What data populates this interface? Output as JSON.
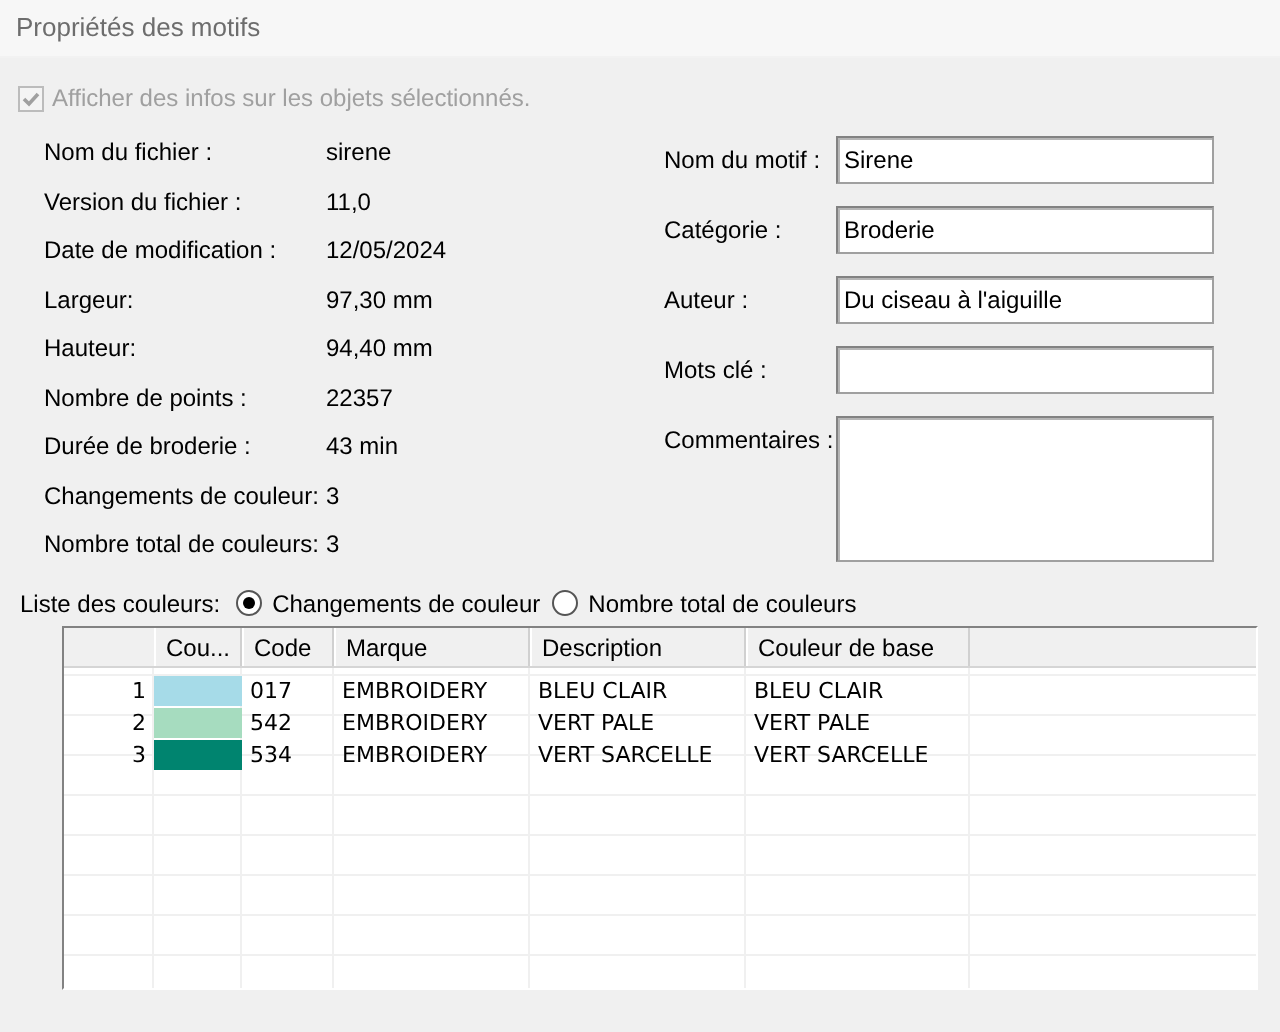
{
  "window": {
    "title": "Propriétés des motifs"
  },
  "show_info": {
    "label": "Afficher des infos sur les objets sélectionnés.",
    "checked": true,
    "disabled": true
  },
  "info": [
    {
      "label": "Nom du fichier :",
      "value": "sirene"
    },
    {
      "label": "Version du fichier :",
      "value": "11,0"
    },
    {
      "label": "Date de modification :",
      "value": "12/05/2024"
    },
    {
      "label": "Largeur:",
      "value": "97,30 mm"
    },
    {
      "label": "Hauteur:",
      "value": "94,40 mm"
    },
    {
      "label": "Nombre de points :",
      "value": "22357"
    },
    {
      "label": "Durée de broderie :",
      "value": "43 min"
    },
    {
      "label": "Changements de couleur:",
      "value": "3"
    },
    {
      "label": "Nombre total de couleurs:",
      "value": "3"
    }
  ],
  "fields": [
    {
      "label": "Nom du motif :",
      "value": "Sirene",
      "kind": "line"
    },
    {
      "label": "Catégorie :",
      "value": "Broderie",
      "kind": "line"
    },
    {
      "label": "Auteur :",
      "value": "Du ciseau à l'aiguille",
      "kind": "line"
    },
    {
      "label": "Mots clé :",
      "kind": "line"
    },
    {
      "label": "Commentaires :",
      "kind": "area"
    }
  ],
  "color_list": {
    "label": "Liste des couleurs:",
    "options": [
      {
        "label": "Changements de couleur",
        "selected": true
      },
      {
        "label": "Nombre total de couleurs",
        "selected": false
      }
    ]
  },
  "table": {
    "columns": [
      "Cou...",
      "Code",
      "Marque",
      "Description",
      "Couleur de base"
    ],
    "rows": [
      {
        "index": "1",
        "color": "#a6dbe8",
        "code": "017",
        "brand": "EMBROIDERY",
        "description": "BLEU CLAIR",
        "base_color": "BLEU CLAIR"
      },
      {
        "index": "2",
        "color": "#a6dcbf",
        "code": "542",
        "brand": "EMBROIDERY",
        "description": "VERT PALE",
        "base_color": "VERT PALE"
      },
      {
        "index": "3",
        "color": "#00846f",
        "code": "534",
        "brand": "EMBROIDERY",
        "description": "VERT SARCELLE",
        "base_color": "VERT SARCELLE"
      }
    ]
  }
}
